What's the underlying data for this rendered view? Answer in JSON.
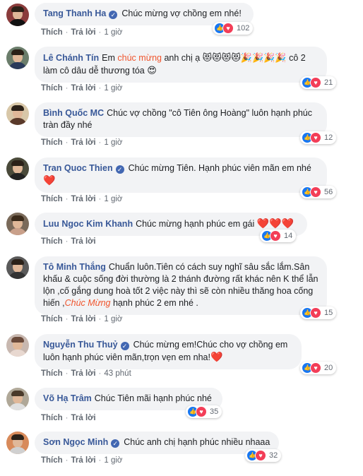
{
  "actions": {
    "like": "Thích",
    "reply": "Trả lời",
    "sep": "·"
  },
  "comments": [
    {
      "name": "Tang Thanh Ha",
      "verified": true,
      "text": "Chúc mừng vợ chồng em nhé!",
      "time": "1 giờ",
      "reactions": "102"
    },
    {
      "name": "Lê Chánh Tín",
      "verified": false,
      "text_a": "Em ",
      "text_hl": "chúc mừng",
      "text_b": " anh chị ạ ",
      "emojis": "😻😻😻😻🎉🎉🎉🎉",
      "text_c": " cô 2 làm cô dâu dễ thương tóa ",
      "emoji_end": "😍",
      "time": "1 giờ",
      "reactions": "21"
    },
    {
      "name": "Bình Quốc MC",
      "verified": false,
      "text": "Chúc vợ chồng \"cô Tiên ông Hoàng\" luôn hạnh phúc tràn đầy nhé",
      "time": "1 giờ",
      "reactions": "12"
    },
    {
      "name": "Tran Quoc Thien",
      "verified": true,
      "text": "Chúc mừng Tiên. Hạnh phúc viên mãn em nhé",
      "emoji_end": "❤️",
      "time": "1 giờ",
      "reactions": "56"
    },
    {
      "name": "Luu Ngoc Kim Khanh",
      "verified": false,
      "text": "Chúc mừng hạnh phúc em gái ",
      "emoji_end": "❤️❤️❤️",
      "time": "",
      "reactions": "14"
    },
    {
      "name": "Tô Minh Thắng",
      "verified": false,
      "text_a": "Chuẩn luôn.Tiên có cách suy nghĩ sâu sắc lắm.Sân khấu & cuộc sống đời thường là 2 thánh đường rất khác nên K thể lẫn lộn ,cố gắng dung hoà tốt 2 việc này thì sẽ còn nhiều thăng hoa cống hiến ,",
      "text_hl": "Chúc Mừng",
      "text_b": " hạnh phúc 2 em nhé .",
      "time": "1 giờ",
      "reactions": "15"
    },
    {
      "name": "Nguyễn Thu Thuỷ",
      "verified": true,
      "text": "Chúc mừng em!Chúc cho vợ chồng em luôn hạnh phúc viên mãn,trọn vẹn em nha!",
      "emoji_end": "❤️",
      "time": "43 phút",
      "reactions": "20"
    },
    {
      "name": "Võ Hạ Trâm",
      "verified": false,
      "text": "Chúc Tiên mãi hạnh phúc nhé",
      "time": "",
      "reactions": "35"
    },
    {
      "name": "Sơn Ngọc Minh",
      "verified": true,
      "text": "Chúc anh chị hạnh phúc nhiều nhaaa",
      "time": "1 giờ",
      "reactions": "32"
    }
  ],
  "icons": {
    "like": "like-icon",
    "love": "love-icon",
    "verified": "verified-badge-icon"
  },
  "colors": {
    "name": "#385898",
    "bubble": "#f2f3f5",
    "like": "#1877f2",
    "love": "#f33e58",
    "highlight": "#f0552d"
  }
}
